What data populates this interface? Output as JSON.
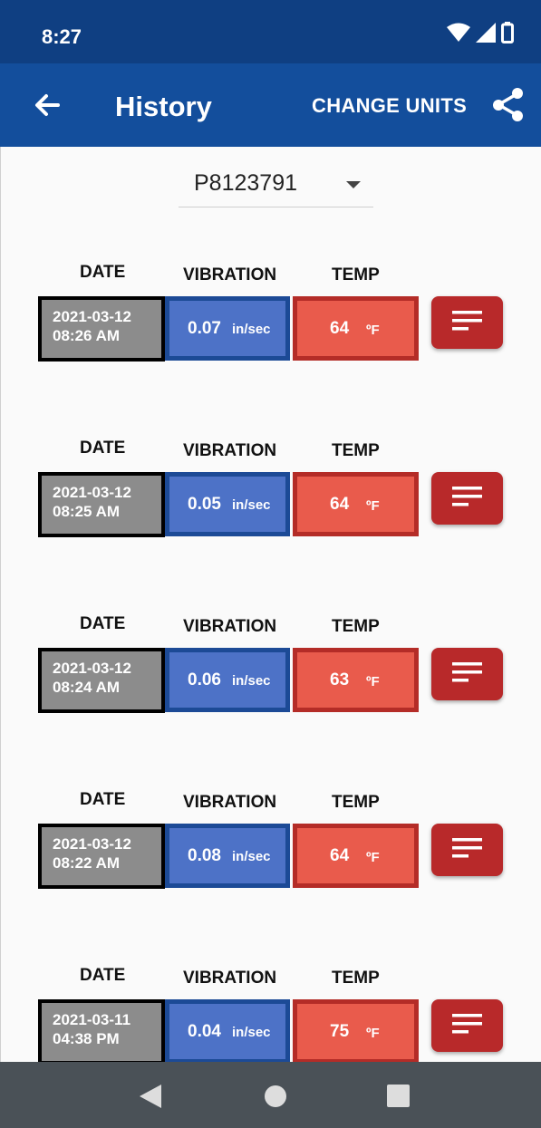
{
  "status": {
    "time": "8:27"
  },
  "header": {
    "title": "History",
    "change_units_label": "CHANGE UNITS"
  },
  "selector": {
    "value": "P8123791"
  },
  "columns": {
    "date": "DATE",
    "vibration": "VIBRATION",
    "temp": "TEMP"
  },
  "records": [
    {
      "date": "2021-03-12",
      "time": "08:26 AM",
      "vibration": "0.07",
      "vib_unit": "in/sec",
      "temp": "64",
      "temp_unit": "ºF"
    },
    {
      "date": "2021-03-12",
      "time": "08:25 AM",
      "vibration": "0.05",
      "vib_unit": "in/sec",
      "temp": "64",
      "temp_unit": "ºF"
    },
    {
      "date": "2021-03-12",
      "time": "08:24 AM",
      "vibration": "0.06",
      "vib_unit": "in/sec",
      "temp": "63",
      "temp_unit": "ºF"
    },
    {
      "date": "2021-03-12",
      "time": "08:22 AM",
      "vibration": "0.08",
      "vib_unit": "in/sec",
      "temp": "64",
      "temp_unit": "ºF"
    },
    {
      "date": "2021-03-11",
      "time": "04:38 PM",
      "vibration": "0.04",
      "vib_unit": "in/sec",
      "temp": "75",
      "temp_unit": "ºF"
    }
  ],
  "colors": {
    "status_bar": "#0f3f82",
    "app_bar": "#134e9c",
    "date_cell": "#8c8c8c",
    "vibration_cell": "#4d72c7",
    "temp_cell": "#e95b4c",
    "detail_button": "#b8292a",
    "nav_bar": "#4a5157"
  },
  "icons": {
    "back": "arrow-left-icon",
    "share": "share-icon",
    "dropdown": "caret-down-icon",
    "detail": "notes-icon",
    "wifi": "wifi-icon",
    "signal": "signal-icon",
    "battery": "battery-icon",
    "nav_back": "triangle-back-icon",
    "nav_home": "circle-home-icon",
    "nav_recent": "square-recent-icon"
  }
}
